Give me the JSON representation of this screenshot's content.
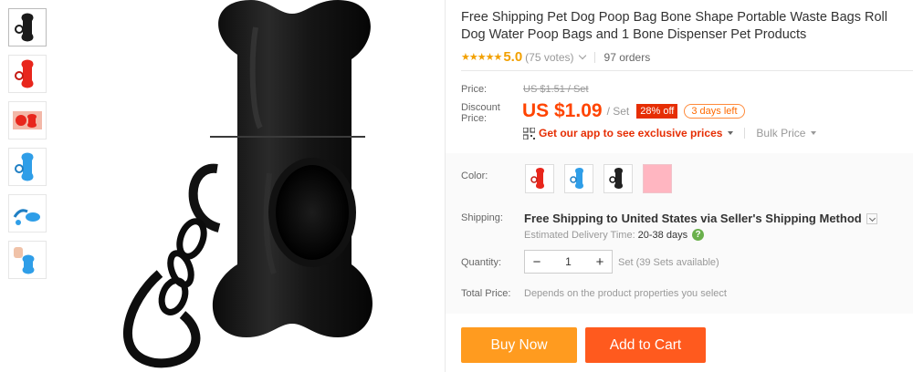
{
  "product": {
    "title": "Free Shipping Pet Dog Poop Bag Bone Shape Portable Waste Bags Roll Dog Water Poop Bags and 1 Bone Dispenser Pet Products"
  },
  "rating": {
    "stars": "★★★★★",
    "score": "5.0",
    "votes": "(75 votes)",
    "orders": "97 orders",
    "star_color": "#f2a000"
  },
  "pricing": {
    "price_label": "Price:",
    "original_price": "US $1.51 / Set",
    "discount_label": "Discount Price:",
    "discount_price": "US $1.09",
    "unit": "/ Set",
    "discount_badge": "28% off",
    "days_left": "3 days left",
    "app_promo": "Get our app to see exclusive prices",
    "bulk_price": "Bulk Price",
    "price_color": "#ff4400"
  },
  "options": {
    "color_label": "Color:",
    "colors": [
      {
        "name": "red",
        "hex": "#e8261c"
      },
      {
        "name": "blue",
        "hex": "#2f9ee8"
      },
      {
        "name": "black",
        "hex": "#222222"
      },
      {
        "name": "pink",
        "hex": "#ffb6c1"
      }
    ],
    "shipping_label": "Shipping:",
    "shipping_method": "Free Shipping to",
    "shipping_dest": "United States via Seller's Shipping Method",
    "eta_label": "Estimated Delivery Time:",
    "eta_value": "20-38 days",
    "help_icon": "?",
    "quantity_label": "Quantity:",
    "quantity_minus": "−",
    "quantity_value": "1",
    "quantity_plus": "+",
    "quantity_note": "Set (39 Sets available)",
    "total_label": "Total Price:",
    "total_note": "Depends on the product properties you select"
  },
  "actions": {
    "buy_now": "Buy Now",
    "add_to_cart": "Add to Cart",
    "buy_color": "#ff9b1f",
    "cart_color": "#ff5a1e"
  },
  "thumbnails": [
    "black-dispenser",
    "red-dispenser",
    "red-dispenser-bags",
    "blue-dispenser",
    "blue-dispenser-leash",
    "blue-dispenser-hand"
  ]
}
